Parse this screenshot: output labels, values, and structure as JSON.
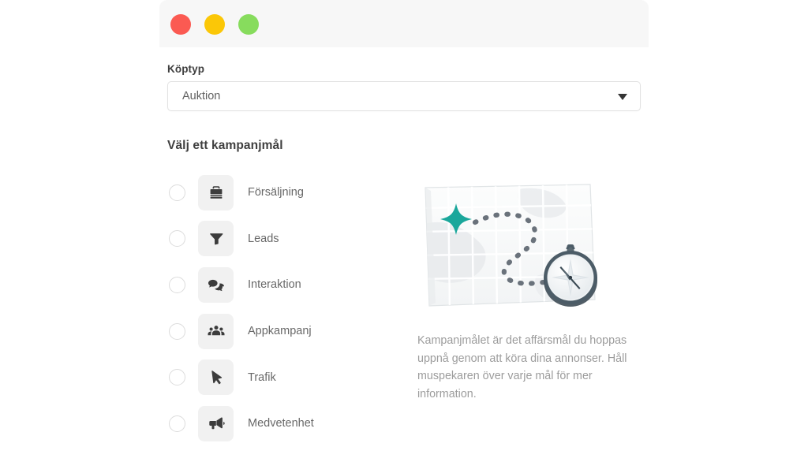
{
  "window": {
    "traffic_lights": [
      {
        "name": "close",
        "color": "#fb5a52"
      },
      {
        "name": "minimize",
        "color": "#fbc707"
      },
      {
        "name": "maximize",
        "color": "#87dc5d"
      }
    ]
  },
  "form": {
    "buy_type_label": "Köptyp",
    "buy_type_value": "Auktion",
    "buy_type_caret_icon": "chevron-down-icon",
    "section_title": "Välj ett kampanjmål"
  },
  "goals": [
    {
      "label": "Försäljning",
      "icon": "briefcase-icon",
      "selected": false
    },
    {
      "label": "Leads",
      "icon": "funnel-icon",
      "selected": false
    },
    {
      "label": "Interaktion",
      "icon": "chat-bubbles-icon",
      "selected": false
    },
    {
      "label": "Appkampanj",
      "icon": "people-group-icon",
      "selected": false
    },
    {
      "label": "Trafik",
      "icon": "cursor-arrow-icon",
      "selected": false
    },
    {
      "label": "Medvetenhet",
      "icon": "megaphone-icon",
      "selected": false
    }
  ],
  "info": {
    "illustration_name": "map-with-compass-illustration",
    "help_text": "Kampanjmålet är det affärsmål du hoppas uppnå genom att köra dina annonser. Håll muspekaren över varje mål för mer information."
  },
  "colors": {
    "titlebar": "#f7f7f7",
    "tile_bg": "#f1f1f1",
    "label_text": "#3f3f3f",
    "goal_text": "#686868",
    "help_text": "#9c9c9c",
    "star_teal": "#1aa79b",
    "compass_ring": "#4c5c67"
  }
}
